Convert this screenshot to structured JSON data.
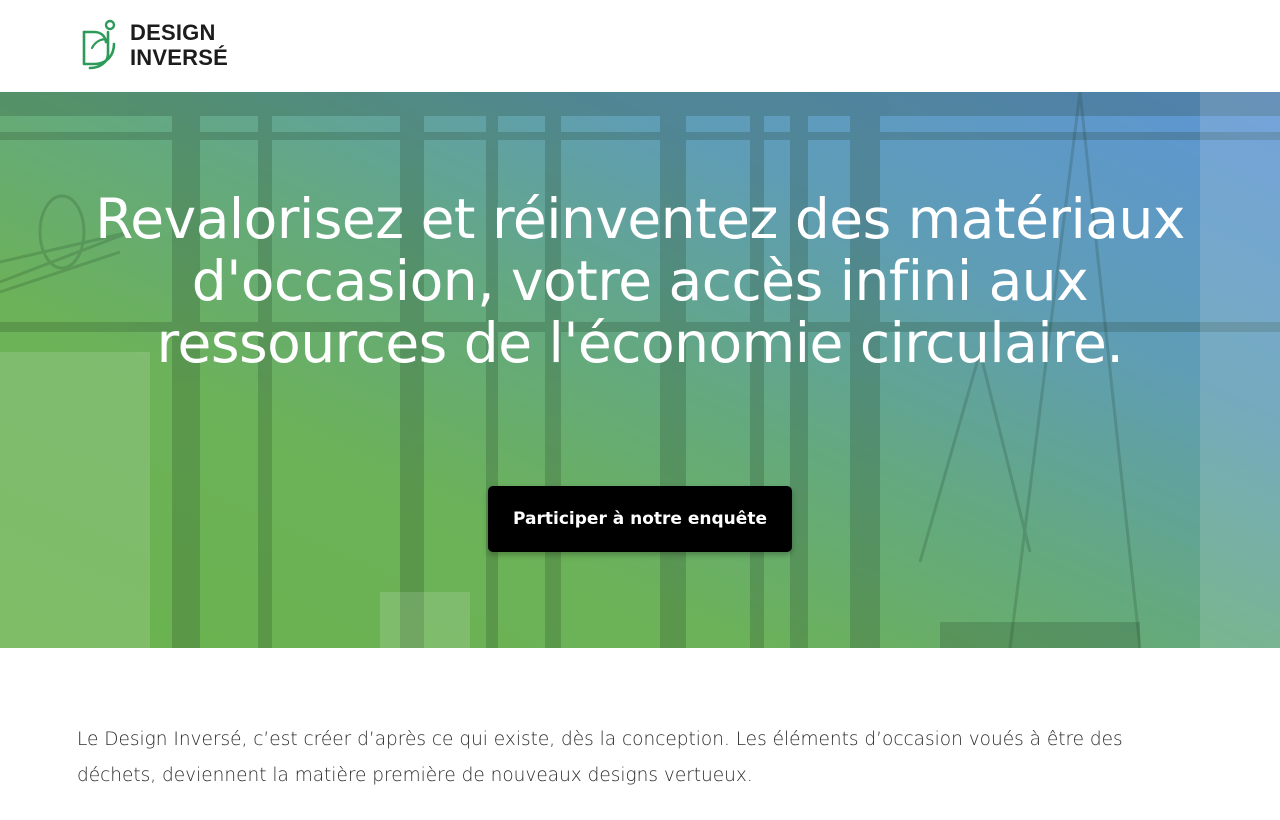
{
  "header": {
    "logo_line1": "DESIGN",
    "logo_line2": "INVERSÉ",
    "logo_icon": "dj-monogram-icon",
    "brand_color": "#2e9a5a"
  },
  "hero": {
    "title": "Revalorisez et réinventez des matériaux d'occasion, votre accès infini aux ressources de l'économie circulaire.",
    "cta_label": "Participer à notre enquête",
    "overlay_colors": [
      "#6ab34e",
      "#5e95d6"
    ]
  },
  "intro": {
    "text": "Le Design Inversé, c’est créer d’après ce qui existe, dès la conception. Les éléments d’occasion voués à être des déchets, deviennent la matière première de nouveaux designs vertueux."
  }
}
